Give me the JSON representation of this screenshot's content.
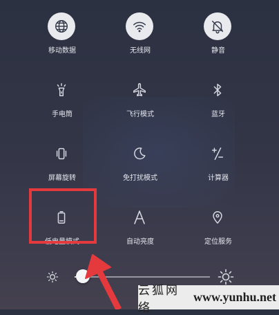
{
  "tiles": [
    {
      "label": "移动数据",
      "icon": "globe-icon",
      "active": true
    },
    {
      "label": "无线网",
      "icon": "wifi-icon",
      "active": true
    },
    {
      "label": "静音",
      "icon": "bell-mute-icon",
      "active": true
    },
    {
      "label": "手电筒",
      "icon": "flashlight-icon",
      "active": false
    },
    {
      "label": "飞行模式",
      "icon": "airplane-icon",
      "active": false
    },
    {
      "label": "蓝牙",
      "icon": "bluetooth-icon",
      "active": false
    },
    {
      "label": "屏幕旋转",
      "icon": "screen-rotate-icon",
      "active": false
    },
    {
      "label": "免打扰模式",
      "icon": "moon-icon",
      "active": false
    },
    {
      "label": "计算器",
      "icon": "calculator-icon",
      "active": false
    },
    {
      "label": "低电量模式",
      "icon": "battery-icon",
      "active": false,
      "highlighted": true
    },
    {
      "label": "自动亮度",
      "icon": "auto-brightness-icon",
      "active": false
    },
    {
      "label": "定位服务",
      "icon": "location-pin-icon",
      "active": false
    }
  ],
  "brightness": {
    "level": 0.06
  },
  "watermark": {
    "cn": "云狐网络",
    "en": "www.yunhu.net"
  },
  "colors": {
    "highlight": "#e53a3d",
    "active_tile": "#e9eaee"
  }
}
